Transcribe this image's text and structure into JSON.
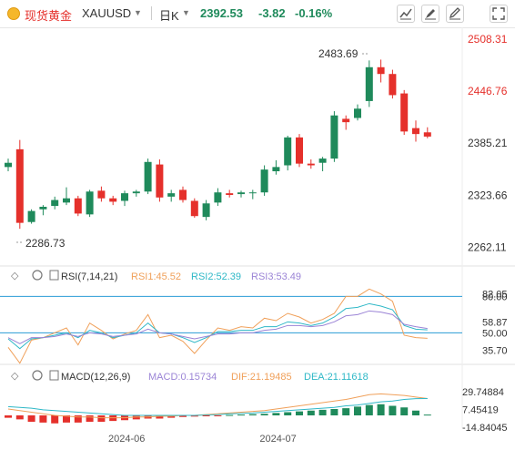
{
  "header": {
    "symbol_cn": "现货黄金",
    "symbol": "XAUUSD",
    "period": "日K",
    "price": "2392.53",
    "change": "-3.82",
    "change_pct": "-0.16%",
    "icons": [
      "indicators-icon",
      "drawing-tools-icon",
      "edit-icon",
      "fullscreen-icon"
    ]
  },
  "main_chart": {
    "y_ticks": [
      "2508.31",
      "2446.76",
      "2385.21",
      "2323.66",
      "2262.11"
    ],
    "y_range": [
      2240,
      2520
    ],
    "high_label": "2483.69",
    "low_label": "2286.73",
    "candles": [
      {
        "o": 2357,
        "h": 2367,
        "l": 2352,
        "c": 2362
      },
      {
        "o": 2378,
        "h": 2389,
        "l": 2284,
        "c": 2291
      },
      {
        "o": 2292,
        "h": 2307,
        "l": 2290,
        "c": 2305
      },
      {
        "o": 2307,
        "h": 2312,
        "l": 2300,
        "c": 2310
      },
      {
        "o": 2311,
        "h": 2322,
        "l": 2307,
        "c": 2318
      },
      {
        "o": 2315,
        "h": 2333,
        "l": 2312,
        "c": 2320
      },
      {
        "o": 2320,
        "h": 2323,
        "l": 2299,
        "c": 2302
      },
      {
        "o": 2301,
        "h": 2330,
        "l": 2298,
        "c": 2328
      },
      {
        "o": 2329,
        "h": 2334,
        "l": 2316,
        "c": 2320
      },
      {
        "o": 2320,
        "h": 2323,
        "l": 2312,
        "c": 2316
      },
      {
        "o": 2317,
        "h": 2329,
        "l": 2311,
        "c": 2326
      },
      {
        "o": 2326,
        "h": 2330,
        "l": 2322,
        "c": 2328
      },
      {
        "o": 2328,
        "h": 2367,
        "l": 2325,
        "c": 2363
      },
      {
        "o": 2360,
        "h": 2366,
        "l": 2316,
        "c": 2321
      },
      {
        "o": 2322,
        "h": 2330,
        "l": 2316,
        "c": 2326
      },
      {
        "o": 2330,
        "h": 2334,
        "l": 2315,
        "c": 2318
      },
      {
        "o": 2317,
        "h": 2320,
        "l": 2297,
        "c": 2299
      },
      {
        "o": 2298,
        "h": 2318,
        "l": 2294,
        "c": 2314
      },
      {
        "o": 2315,
        "h": 2332,
        "l": 2311,
        "c": 2327
      },
      {
        "o": 2326,
        "h": 2330,
        "l": 2321,
        "c": 2324
      },
      {
        "o": 2325,
        "h": 2329,
        "l": 2321,
        "c": 2327
      },
      {
        "o": 2326,
        "h": 2330,
        "l": 2319,
        "c": 2327
      },
      {
        "o": 2327,
        "h": 2359,
        "l": 2323,
        "c": 2354
      },
      {
        "o": 2352,
        "h": 2365,
        "l": 2348,
        "c": 2357
      },
      {
        "o": 2359,
        "h": 2394,
        "l": 2353,
        "c": 2392
      },
      {
        "o": 2392,
        "h": 2396,
        "l": 2357,
        "c": 2361
      },
      {
        "o": 2361,
        "h": 2366,
        "l": 2355,
        "c": 2359
      },
      {
        "o": 2362,
        "h": 2369,
        "l": 2352,
        "c": 2367
      },
      {
        "o": 2367,
        "h": 2423,
        "l": 2363,
        "c": 2418
      },
      {
        "o": 2414,
        "h": 2418,
        "l": 2401,
        "c": 2410
      },
      {
        "o": 2415,
        "h": 2431,
        "l": 2412,
        "c": 2426
      },
      {
        "o": 2435,
        "h": 2483,
        "l": 2428,
        "c": 2475
      },
      {
        "o": 2475,
        "h": 2484,
        "l": 2457,
        "c": 2467
      },
      {
        "o": 2467,
        "h": 2472,
        "l": 2438,
        "c": 2442
      },
      {
        "o": 2444,
        "h": 2448,
        "l": 2395,
        "c": 2399
      },
      {
        "o": 2403,
        "h": 2412,
        "l": 2387,
        "c": 2396
      },
      {
        "o": 2398,
        "h": 2404,
        "l": 2391,
        "c": 2393
      }
    ]
  },
  "rsi": {
    "title": "RSI(7,14,21)",
    "rsi1_label": "RSI1:45.52",
    "rsi2_label": "RSI2:52.39",
    "rsi3_label": "RSI3:53.49",
    "y_ticks": [
      "80.00",
      "82.05",
      "58.87",
      "50.00",
      "35.70"
    ],
    "rsi1": [
      38,
      25,
      44,
      46,
      50,
      54,
      40,
      58,
      52,
      45,
      49,
      52,
      65,
      46,
      48,
      43,
      33,
      44,
      54,
      52,
      55,
      54,
      62,
      60,
      66,
      63,
      58,
      61,
      66,
      80,
      80,
      86,
      82,
      76,
      48,
      46,
      45.5
    ],
    "rsi2": [
      45,
      37,
      45,
      46,
      48,
      50,
      46,
      52,
      50,
      46,
      48,
      50,
      58,
      50,
      49,
      46,
      42,
      46,
      51,
      51,
      52,
      52,
      55,
      55,
      59,
      58,
      56,
      58,
      63,
      70,
      71,
      74,
      72,
      69,
      56,
      53,
      52.4
    ],
    "rsi3": [
      46,
      41,
      46,
      46,
      47,
      49,
      47,
      50,
      49,
      47,
      48,
      49,
      53,
      50,
      49,
      47,
      45,
      47,
      49,
      49,
      50,
      50,
      52,
      53,
      56,
      56,
      55,
      56,
      59,
      64,
      65,
      68,
      67,
      65,
      57,
      55,
      53.5
    ]
  },
  "macd": {
    "title": "MACD(12,26,9)",
    "macd_label": "MACD:0.15734",
    "dif_label": "DIF:21.19485",
    "dea_label": "DEA:21.11618",
    "y_ticks": [
      "29.74884",
      "7.45419",
      "-14.84045"
    ],
    "hist": [
      -3,
      -5,
      -8,
      -9,
      -10,
      -9,
      -9,
      -8,
      -8,
      -7,
      -6,
      -5,
      -4,
      -4,
      -3,
      -2,
      -1.5,
      -1,
      -0.5,
      0.5,
      1,
      1.5,
      2,
      3,
      4,
      5,
      6,
      7,
      8,
      9,
      11,
      13,
      14,
      12,
      10,
      6,
      1
    ],
    "dif": [
      8,
      6,
      4,
      2,
      0,
      -1,
      -2,
      -2,
      -3,
      -3,
      -3,
      -2,
      -2,
      -1,
      -1,
      0,
      0,
      1,
      2,
      3,
      4,
      5,
      6,
      8,
      10,
      12,
      14,
      16,
      18,
      20,
      23,
      26,
      27,
      26,
      25,
      23,
      21.2
    ],
    "dea": [
      11,
      10,
      9,
      7,
      6,
      5,
      4,
      3,
      2,
      1,
      0,
      0,
      0,
      0,
      0,
      0,
      0,
      0.5,
      1,
      2,
      2.5,
      3,
      4,
      5,
      6,
      7,
      8,
      9,
      10,
      12,
      13,
      15,
      17,
      18,
      20,
      21,
      21.1
    ]
  },
  "x_axis": {
    "labels": [
      {
        "text": "2024-06",
        "index": 10
      },
      {
        "text": "2024-07",
        "index": 23
      }
    ]
  },
  "colors": {
    "up": "#1f8a5b",
    "down": "#e5302b",
    "rsi1": "#f0a05a",
    "rsi2": "#2fb8c7",
    "rsi3": "#9b84d6",
    "dif": "#f0a05a",
    "dea": "#2fb8c7",
    "ref_line": "#2a9bd6",
    "price_axis_red": "#e5302b"
  }
}
